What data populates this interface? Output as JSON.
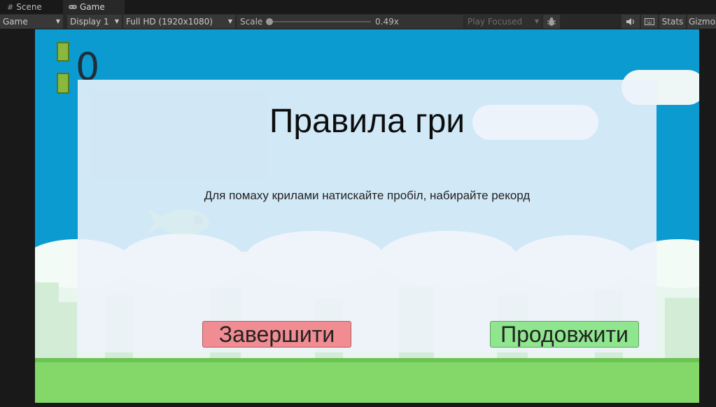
{
  "tabs": [
    {
      "label": "Scene",
      "icon": "grid-icon"
    },
    {
      "label": "Game",
      "icon": "gamepad-icon"
    }
  ],
  "toolbar": {
    "view_mode": "Game",
    "display": "Display 1",
    "resolution": "Full HD (1920x1080)",
    "scale_label": "Scale",
    "scale_value": "0.49x",
    "scale_fraction": 0.0,
    "play_mode": "Play Focused",
    "stats_label": "Stats",
    "gizmos_label": "Gizmos"
  },
  "game": {
    "score": "0",
    "rules_title": "Правила гри",
    "rules_text": "Для помаху крилами натискайте пробіл, набирайте рекорд",
    "quit_label": "Завершити",
    "continue_label": "Продовжити"
  },
  "colors": {
    "sky": "#0b9bd1",
    "quit_button": "#f08c92",
    "continue_button": "#8fe68f",
    "ground": "#84d86a"
  }
}
